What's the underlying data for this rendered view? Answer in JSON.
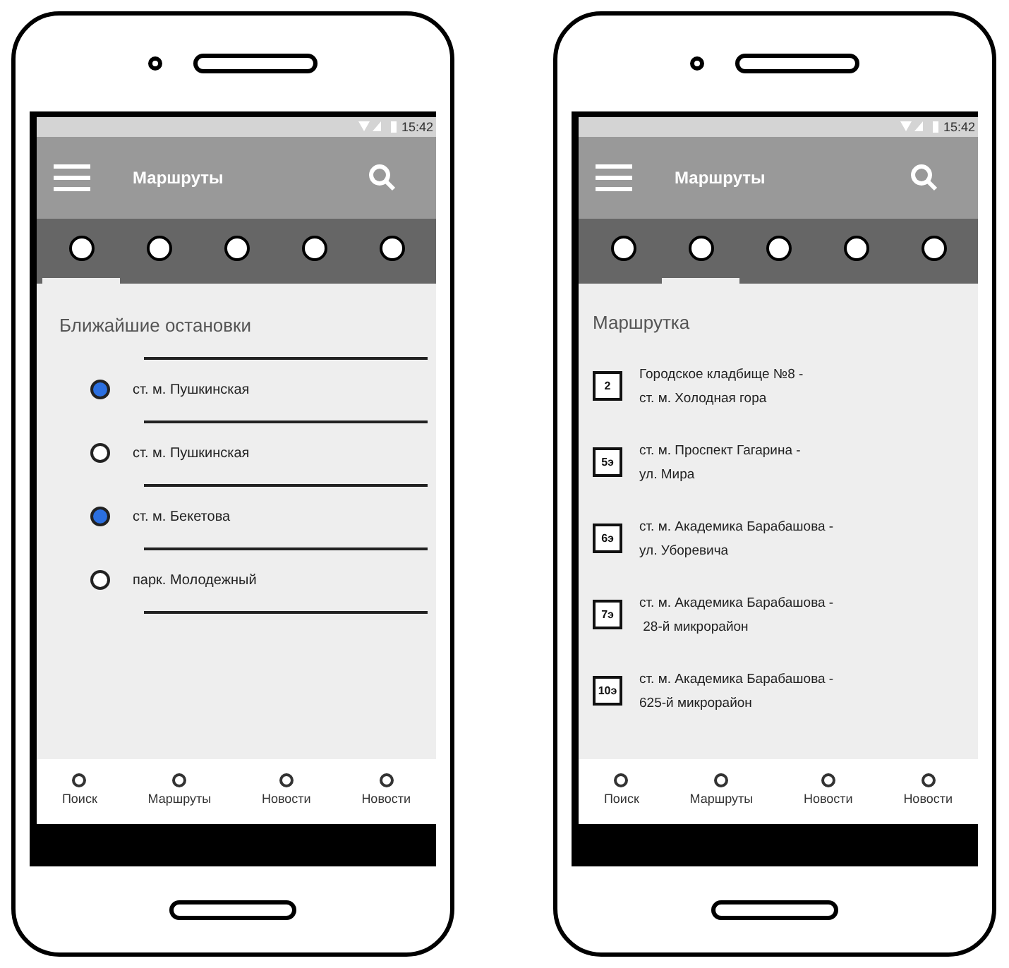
{
  "phones": [
    {
      "status_time": "15:42",
      "title": "Маршруты",
      "tabs": [
        {
          "selected": true
        },
        {
          "selected": false
        },
        {
          "selected": false
        },
        {
          "selected": false
        },
        {
          "selected": false
        }
      ],
      "content": {
        "kind": "stops",
        "heading": "Ближайшие остановки",
        "items": [
          {
            "label": "ст. м. Пушкинская",
            "selected": true
          },
          {
            "label": "ст. м. Пушкинская",
            "selected": false
          },
          {
            "label": "ст. м. Бекетова",
            "selected": true
          },
          {
            "label": "парк. Молодежный",
            "selected": false
          }
        ]
      },
      "nav": [
        "Поиск",
        "Маршруты",
        "Новости",
        "Новости"
      ]
    },
    {
      "status_time": "15:42",
      "title": "Маршруты",
      "tabs": [
        {
          "selected": false
        },
        {
          "selected": true
        },
        {
          "selected": false
        },
        {
          "selected": false
        },
        {
          "selected": false
        }
      ],
      "content": {
        "kind": "routes",
        "heading": "Маршрутка",
        "items": [
          {
            "number": "2",
            "name": "Городское кладбище №8 -\nст. м. Холодная гора"
          },
          {
            "number": "5э",
            "name": "ст. м. Проспект Гагарина -\nул. Мира"
          },
          {
            "number": "6э",
            "name": "ст. м. Академика Барабашова -\nул. Уборевича"
          },
          {
            "number": "7э",
            "name": "ст. м. Академика Барабашова -\n 28-й микрорайон"
          },
          {
            "number": "10э",
            "name": "ст. м. Академика Барабашова -\n625-й микрорайон"
          }
        ]
      },
      "nav": [
        "Поиск",
        "Маршруты",
        "Новости",
        "Новости"
      ]
    }
  ]
}
